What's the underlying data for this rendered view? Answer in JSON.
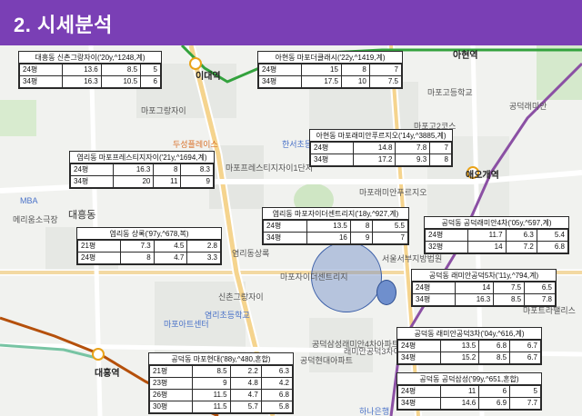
{
  "header": {
    "title": "2. 시세분석"
  },
  "map": {
    "labels": [
      {
        "text": "아현역"
      },
      {
        "text": "이대역"
      },
      {
        "text": "애오개역"
      },
      {
        "text": "대흥역"
      },
      {
        "text": "마포그랑자이"
      },
      {
        "text": "마포고등학교"
      },
      {
        "text": "신촌그랑자이"
      },
      {
        "text": "마포프레스티지자이1단지"
      },
      {
        "text": "염리동상록"
      },
      {
        "text": "마포자이더센트리지"
      },
      {
        "text": "마포래미안푸르지오"
      },
      {
        "text": "대흥동"
      },
      {
        "text": "염리초등학교"
      },
      {
        "text": "공덕삼성래미안4차아파트"
      },
      {
        "text": "래미안공덕3차아파트"
      },
      {
        "text": "공덕현대아파트"
      },
      {
        "text": "공덕래미안"
      },
      {
        "text": "하나은행"
      },
      {
        "text": "서울서부지방법원"
      },
      {
        "text": "마포고2코스"
      },
      {
        "text": "한서초등학교"
      },
      {
        "text": "마포트라팰리스"
      },
      {
        "text": "마포아트센터"
      },
      {
        "text": "두성플레이스"
      },
      {
        "text": "MBA"
      },
      {
        "text": "메리움소극장"
      }
    ],
    "cards": [
      {
        "title": "대흥동 신촌그랑자이('20y,^1248,계)",
        "rows": [
          [
            "24평",
            "13.6",
            "8.5",
            "5"
          ],
          [
            "34평",
            "16.3",
            "10.5",
            "6"
          ]
        ]
      },
      {
        "title": "아현동 마포더클래시('22y,^1419,계)",
        "rows": [
          [
            "24평",
            "15",
            "8",
            "7"
          ],
          [
            "34평",
            "17.5",
            "10",
            "7.5"
          ]
        ]
      },
      {
        "title": "아현동 마포래미안푸르지오('14y,^3885,계)",
        "rows": [
          [
            "24평",
            "14.8",
            "7.8",
            "7"
          ],
          [
            "34평",
            "17.2",
            "9.3",
            "8"
          ]
        ]
      },
      {
        "title": "염리동 마포프레스티지자이('21y,^1694,계)",
        "rows": [
          [
            "24평",
            "16.3",
            "8",
            "8.3"
          ],
          [
            "34평",
            "20",
            "11",
            "9"
          ]
        ]
      },
      {
        "title": "염리동 마포자이더센트리지('18y,^927,계)",
        "rows": [
          [
            "24평",
            "13.5",
            "8",
            "5.5"
          ],
          [
            "34평",
            "16",
            "9",
            "7"
          ]
        ]
      },
      {
        "title": "공덕동 공덕래미안4차('05y,^597,계)",
        "rows": [
          [
            "24평",
            "11.7",
            "6.3",
            "5.4"
          ],
          [
            "32평",
            "14",
            "7.2",
            "6.8"
          ]
        ]
      },
      {
        "title": "염리동 상록('97y,^678,복)",
        "rows": [
          [
            "21평",
            "7.3",
            "4.5",
            "2.8"
          ],
          [
            "24평",
            "8",
            "4.7",
            "3.3"
          ]
        ]
      },
      {
        "title": "공덕동 래미안공덕5차('11y,^794,계)",
        "rows": [
          [
            "24평",
            "14",
            "7.5",
            "6.5"
          ],
          [
            "34평",
            "16.3",
            "8.5",
            "7.8"
          ]
        ]
      },
      {
        "title": "공덕동 래미안공덕3차('04y,^616,계)",
        "rows": [
          [
            "24평",
            "13.5",
            "6.8",
            "6.7"
          ],
          [
            "34평",
            "15.2",
            "8.5",
            "6.7"
          ]
        ]
      },
      {
        "title": "공덕동 마포현대('88y,^480,혼합)",
        "rows": [
          [
            "21평",
            "8.5",
            "2.2",
            "6.3"
          ],
          [
            "23평",
            "9",
            "4.8",
            "4.2"
          ],
          [
            "26평",
            "11.5",
            "4.7",
            "6.8"
          ],
          [
            "30평",
            "11.5",
            "5.7",
            "5.8"
          ]
        ]
      },
      {
        "title": "공덕동 공덕삼성('99y,^651,혼합)",
        "rows": [
          [
            "24평",
            "11",
            "6",
            "5"
          ],
          [
            "34평",
            "14.6",
            "6.9",
            "7.7"
          ]
        ]
      }
    ]
  },
  "colors": {
    "header": "#7a3fb5",
    "line2": "#33a23d",
    "line5": "#8b50a4",
    "line6": "#b5500b",
    "gyeongui": "#77c4a3"
  }
}
